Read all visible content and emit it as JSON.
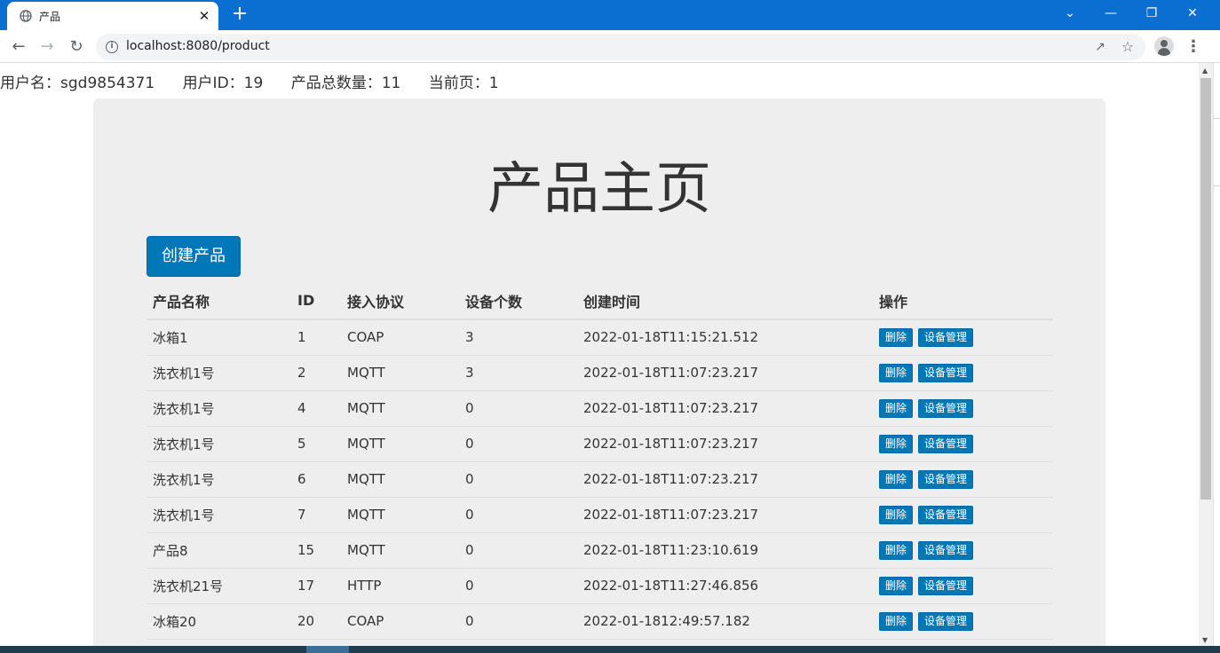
{
  "browser": {
    "tab_title": "产品",
    "url": "localhost:8080/product",
    "tab_close": "✕",
    "new_tab": "+",
    "window_controls": [
      "⌄",
      "—",
      "❐",
      "✕"
    ]
  },
  "userinfo": {
    "username": "用户名：sgd9854371",
    "user_id": "用户ID：19",
    "product_total": "产品总数量：11",
    "current_page": "当前页：1"
  },
  "page": {
    "title": "产品主页",
    "create_button": "创建产品"
  },
  "table": {
    "headers": [
      "产品名称",
      "ID",
      "接入协议",
      "设备个数",
      "创建时间",
      "操作"
    ],
    "delete_label": "删除",
    "manage_label": "设备管理",
    "rows": [
      [
        "冰箱1",
        "1",
        "COAP",
        "3",
        "2022-01-18T11:15:21.512"
      ],
      [
        "洗衣机1号",
        "2",
        "MQTT",
        "3",
        "2022-01-18T11:07:23.217"
      ],
      [
        "洗衣机1号",
        "4",
        "MQTT",
        "0",
        "2022-01-18T11:07:23.217"
      ],
      [
        "洗衣机1号",
        "5",
        "MQTT",
        "0",
        "2022-01-18T11:07:23.217"
      ],
      [
        "洗衣机1号",
        "6",
        "MQTT",
        "0",
        "2022-01-18T11:07:23.217"
      ],
      [
        "洗衣机1号",
        "7",
        "MQTT",
        "0",
        "2022-01-18T11:07:23.217"
      ],
      [
        "产品8",
        "15",
        "MQTT",
        "0",
        "2022-01-18T11:23:10.619"
      ],
      [
        "洗衣机21号",
        "17",
        "HTTP",
        "0",
        "2022-01-18T11:27:46.856"
      ],
      [
        "冰箱20",
        "20",
        "COAP",
        "0",
        "2022-01-1812:49:57.182"
      ]
    ]
  },
  "colors": {
    "titlebar": "#0a6fd0",
    "primary_button": "#0078b8",
    "jumbotron": "#eeeeee"
  }
}
